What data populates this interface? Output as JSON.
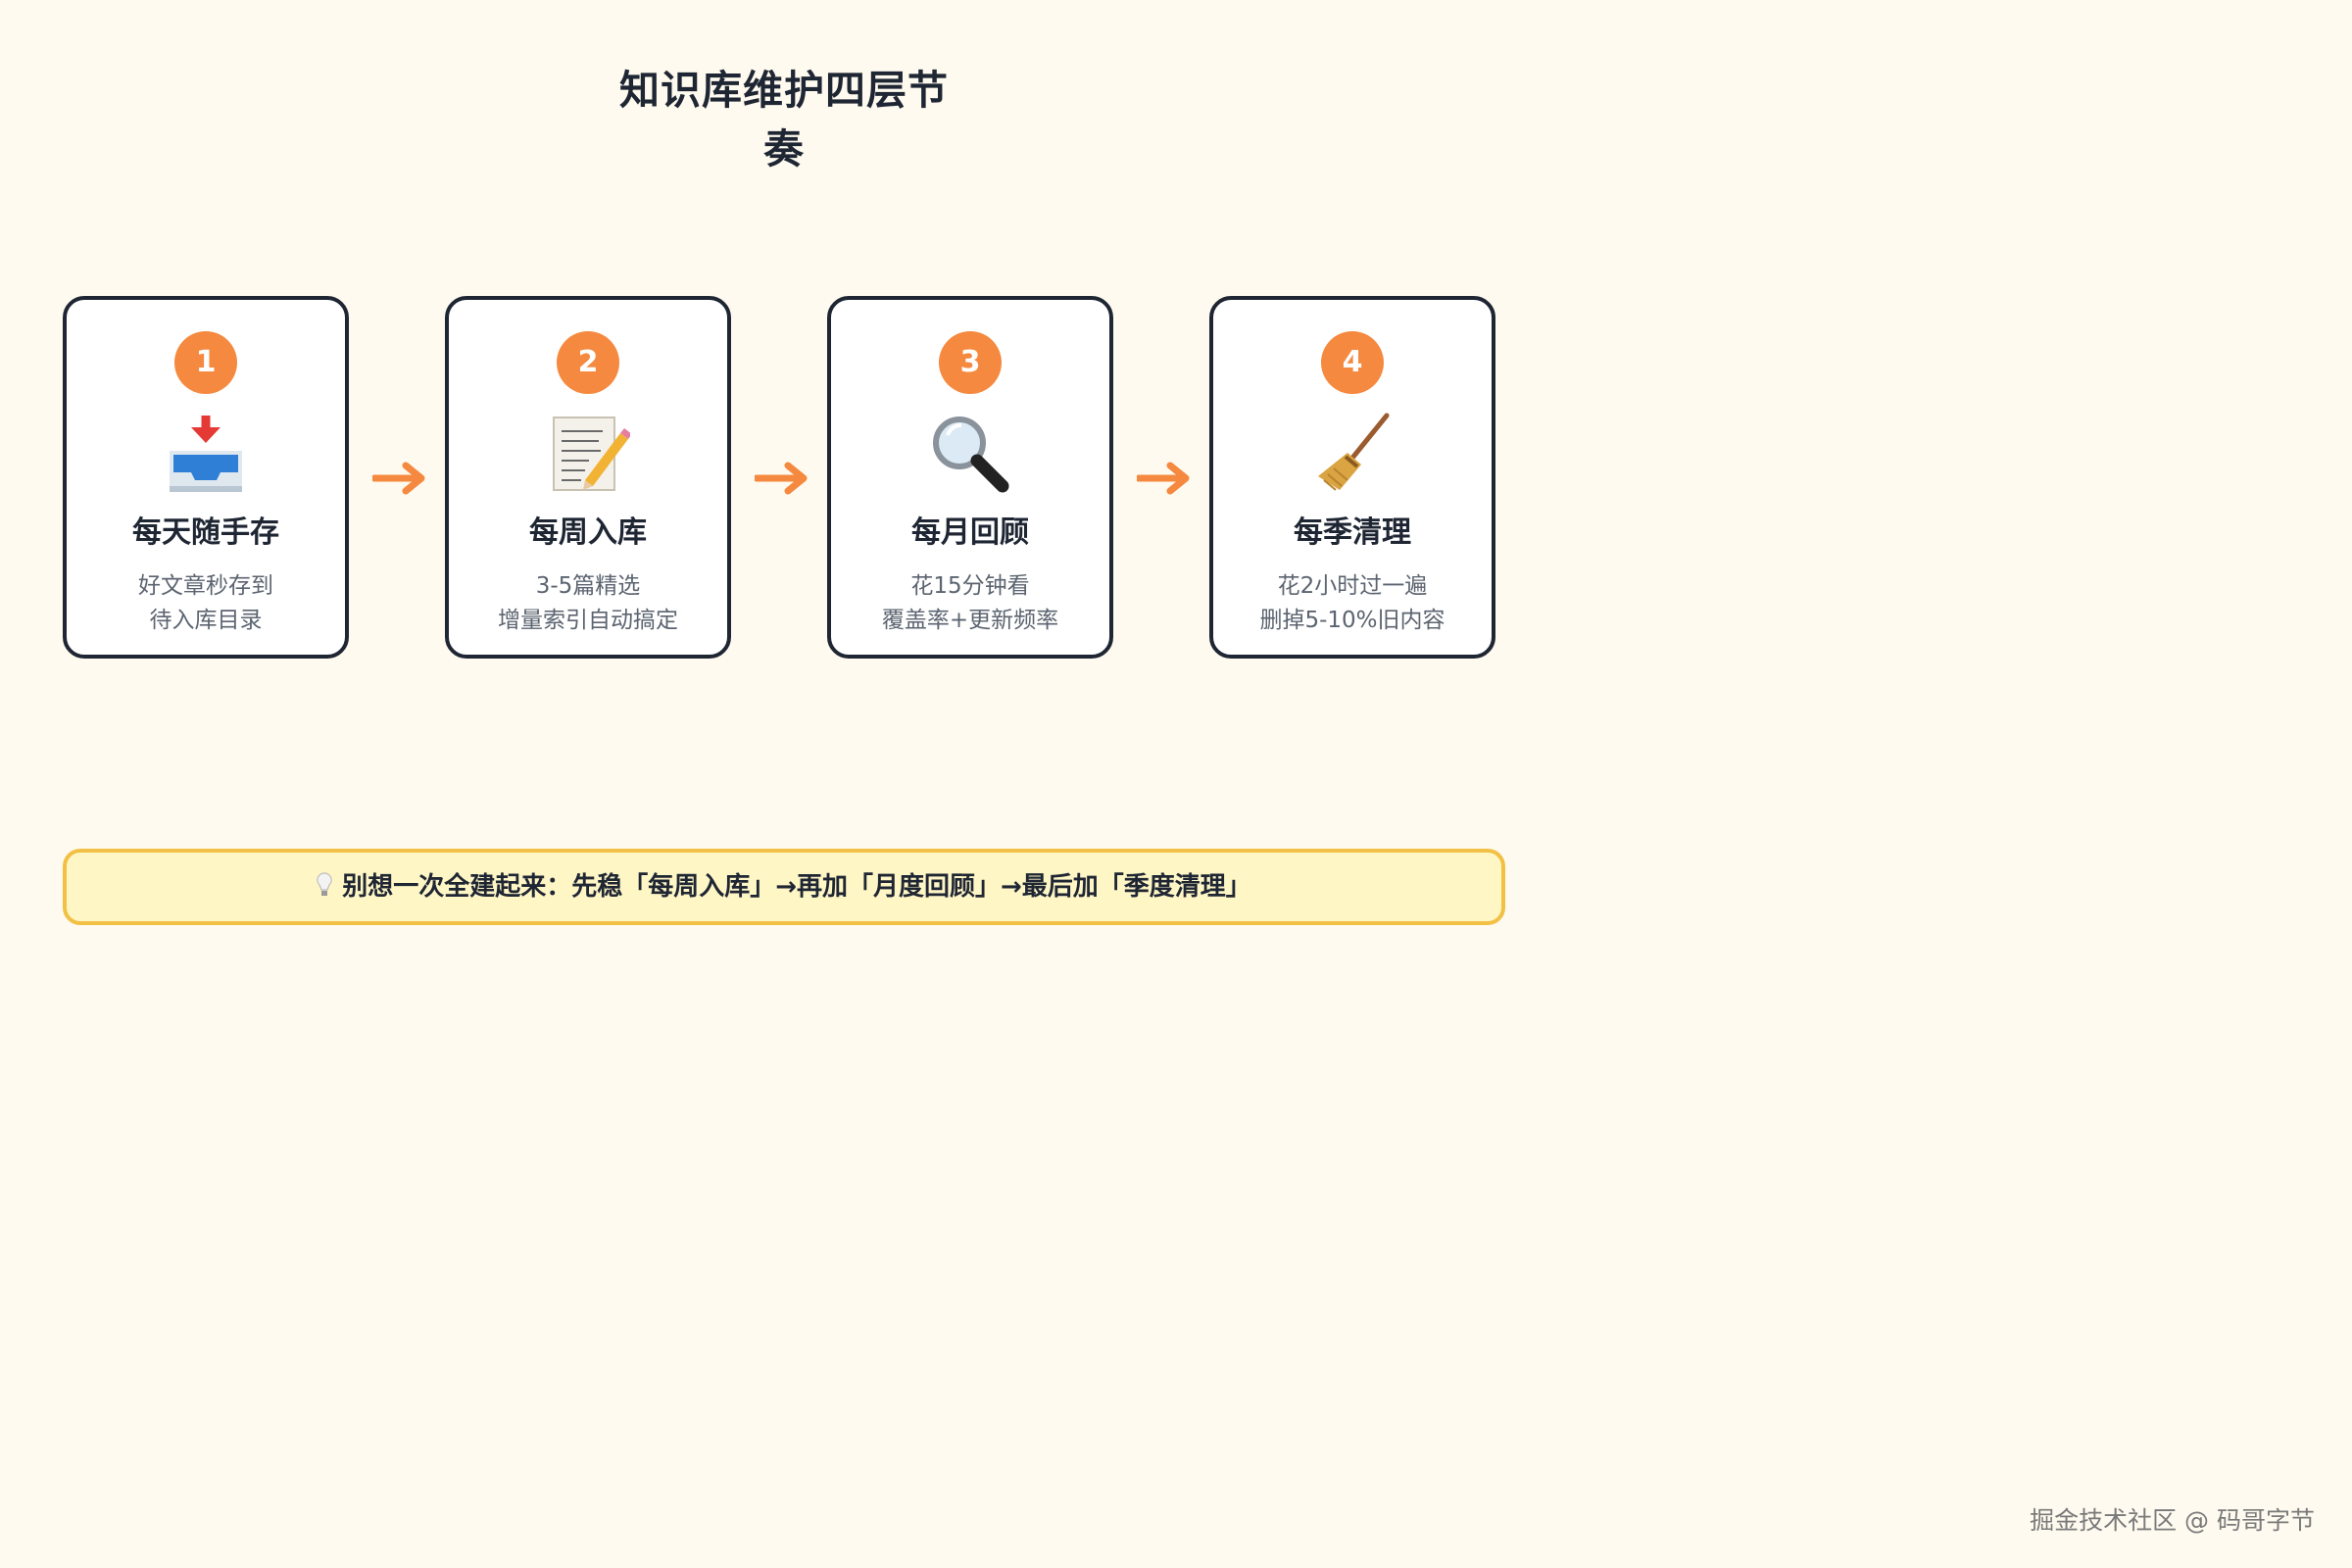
{
  "title": "知识库维护四层节奏",
  "colors": {
    "background": "#fffaef",
    "accent": "#f5893f",
    "card_border": "#1f2633",
    "tip_border": "#f2c044",
    "tip_background": "#fff6c6"
  },
  "steps": [
    {
      "number": "1",
      "icon": "inbox-tray-icon",
      "title": "每天随手存",
      "desc1": "好文章秒存到",
      "desc2": "待入库目录"
    },
    {
      "number": "2",
      "icon": "memo-icon",
      "title": "每周入库",
      "desc1": "3-5篇精选",
      "desc2": "增量索引自动搞定"
    },
    {
      "number": "3",
      "icon": "magnifier-icon",
      "title": "每月回顾",
      "desc1": "花15分钟看",
      "desc2": "覆盖率+更新频率"
    },
    {
      "number": "4",
      "icon": "broom-icon",
      "title": "每季清理",
      "desc1": "花2小时过一遍",
      "desc2": "删掉5-10%旧内容"
    }
  ],
  "tip": {
    "icon": "lightbulb-icon",
    "text": "别想一次全建起来：先稳「每周入库」→再加「月度回顾」→最后加「季度清理」"
  },
  "footer": "掘金技术社区 @ 码哥字节"
}
